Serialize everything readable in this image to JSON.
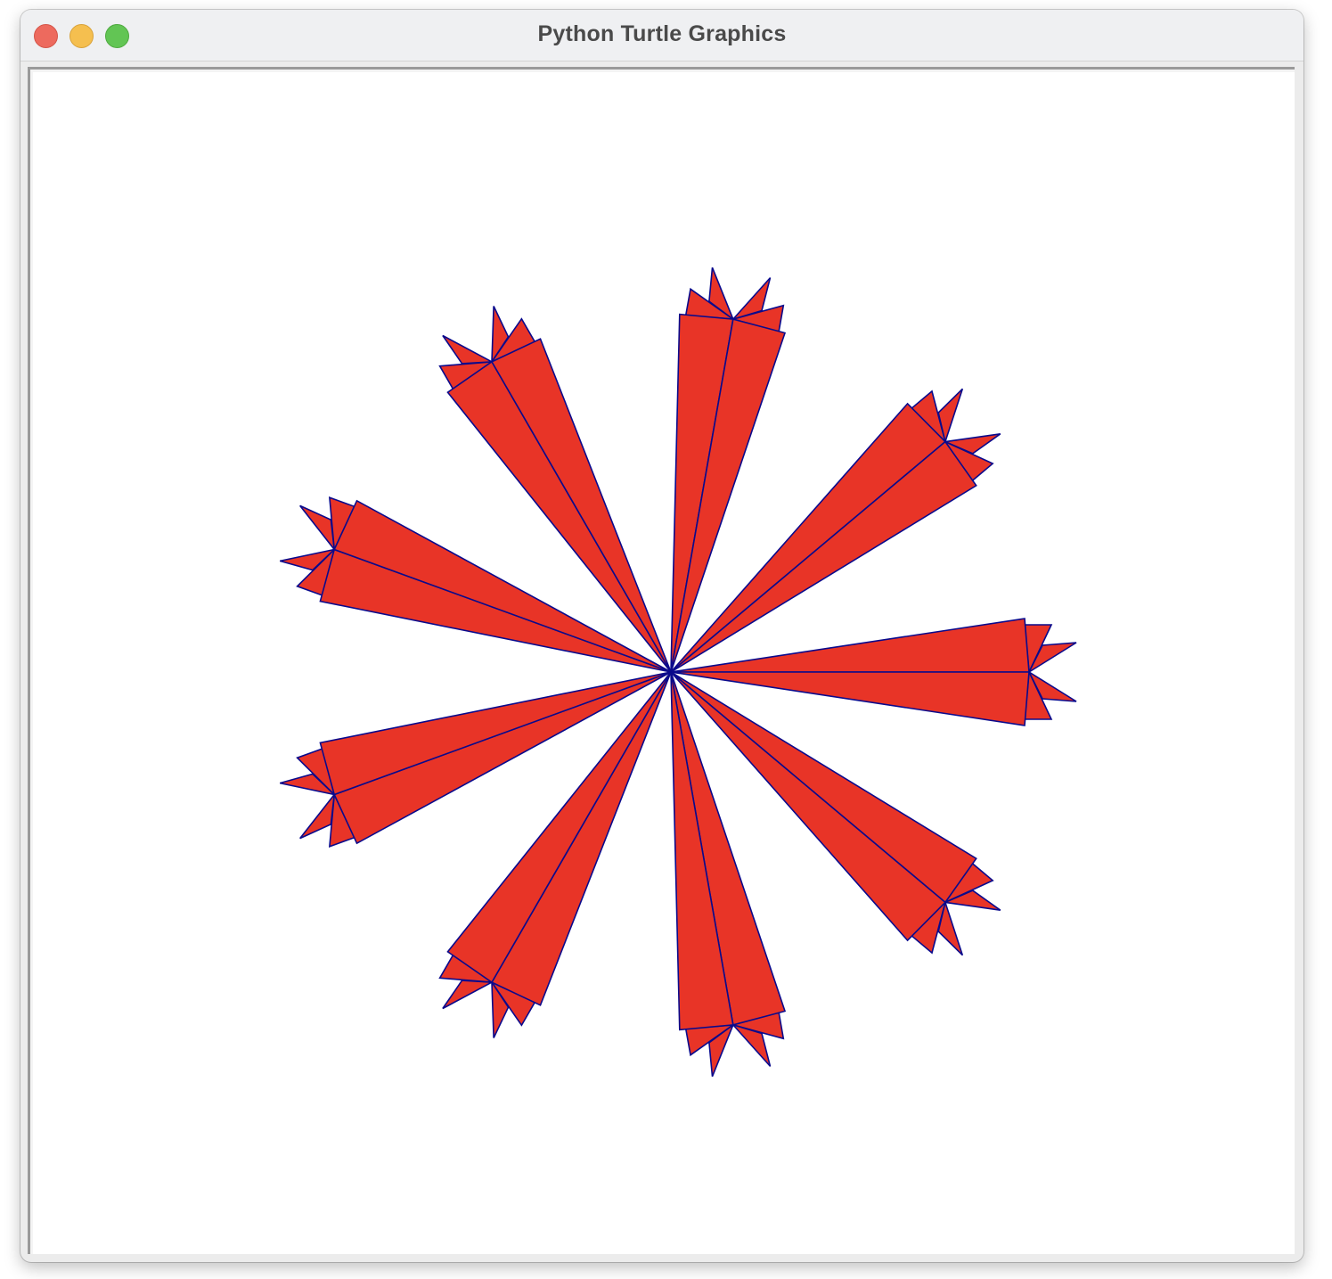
{
  "window": {
    "title": "Python Turtle Graphics",
    "controls": {
      "close": "close",
      "minimize": "minimize",
      "zoom": "zoom"
    }
  },
  "drawing": {
    "fill_color": "#e83427",
    "pen_color": "#0a0a8c",
    "background": "#ffffff",
    "petal_count": 9,
    "petal_headings_deg": [
      0,
      40,
      80,
      120,
      160,
      200,
      240,
      280,
      320
    ]
  }
}
